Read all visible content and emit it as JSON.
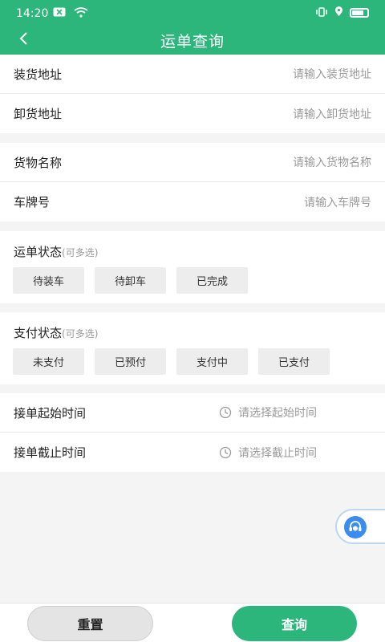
{
  "status_bar": {
    "time": "14:20",
    "left_icons": [
      "notification-x-icon",
      "wifi-icon"
    ],
    "right_icons": [
      "vibrate-icon",
      "location-icon",
      "battery-icon"
    ]
  },
  "header": {
    "title": "运单查询",
    "back_icon": "chevron-left-icon"
  },
  "address": {
    "load_label": "装货地址",
    "load_placeholder": "请输入装货地址",
    "unload_label": "卸货地址",
    "unload_placeholder": "请输入卸货地址"
  },
  "cargo": {
    "goods_label": "货物名称",
    "goods_placeholder": "请输入货物名称",
    "plate_label": "车牌号",
    "plate_placeholder": "请输入车牌号"
  },
  "waybill_status": {
    "title": "运单状态",
    "note": "(可多选)",
    "options": [
      "待装车",
      "待卸车",
      "已完成"
    ]
  },
  "payment_status": {
    "title": "支付状态",
    "note": "(可多选)",
    "options": [
      "未支付",
      "已预付",
      "支付中",
      "已支付"
    ]
  },
  "time": {
    "start_label": "接单起始时间",
    "start_placeholder": "请选择起始时间",
    "end_label": "接单截止时间",
    "end_placeholder": "请选择截止时间"
  },
  "actions": {
    "reset": "重置",
    "query": "查询"
  },
  "colors": {
    "primary": "#2db67c",
    "chip_bg": "#ededed",
    "float_button": "#3b8cf2"
  }
}
